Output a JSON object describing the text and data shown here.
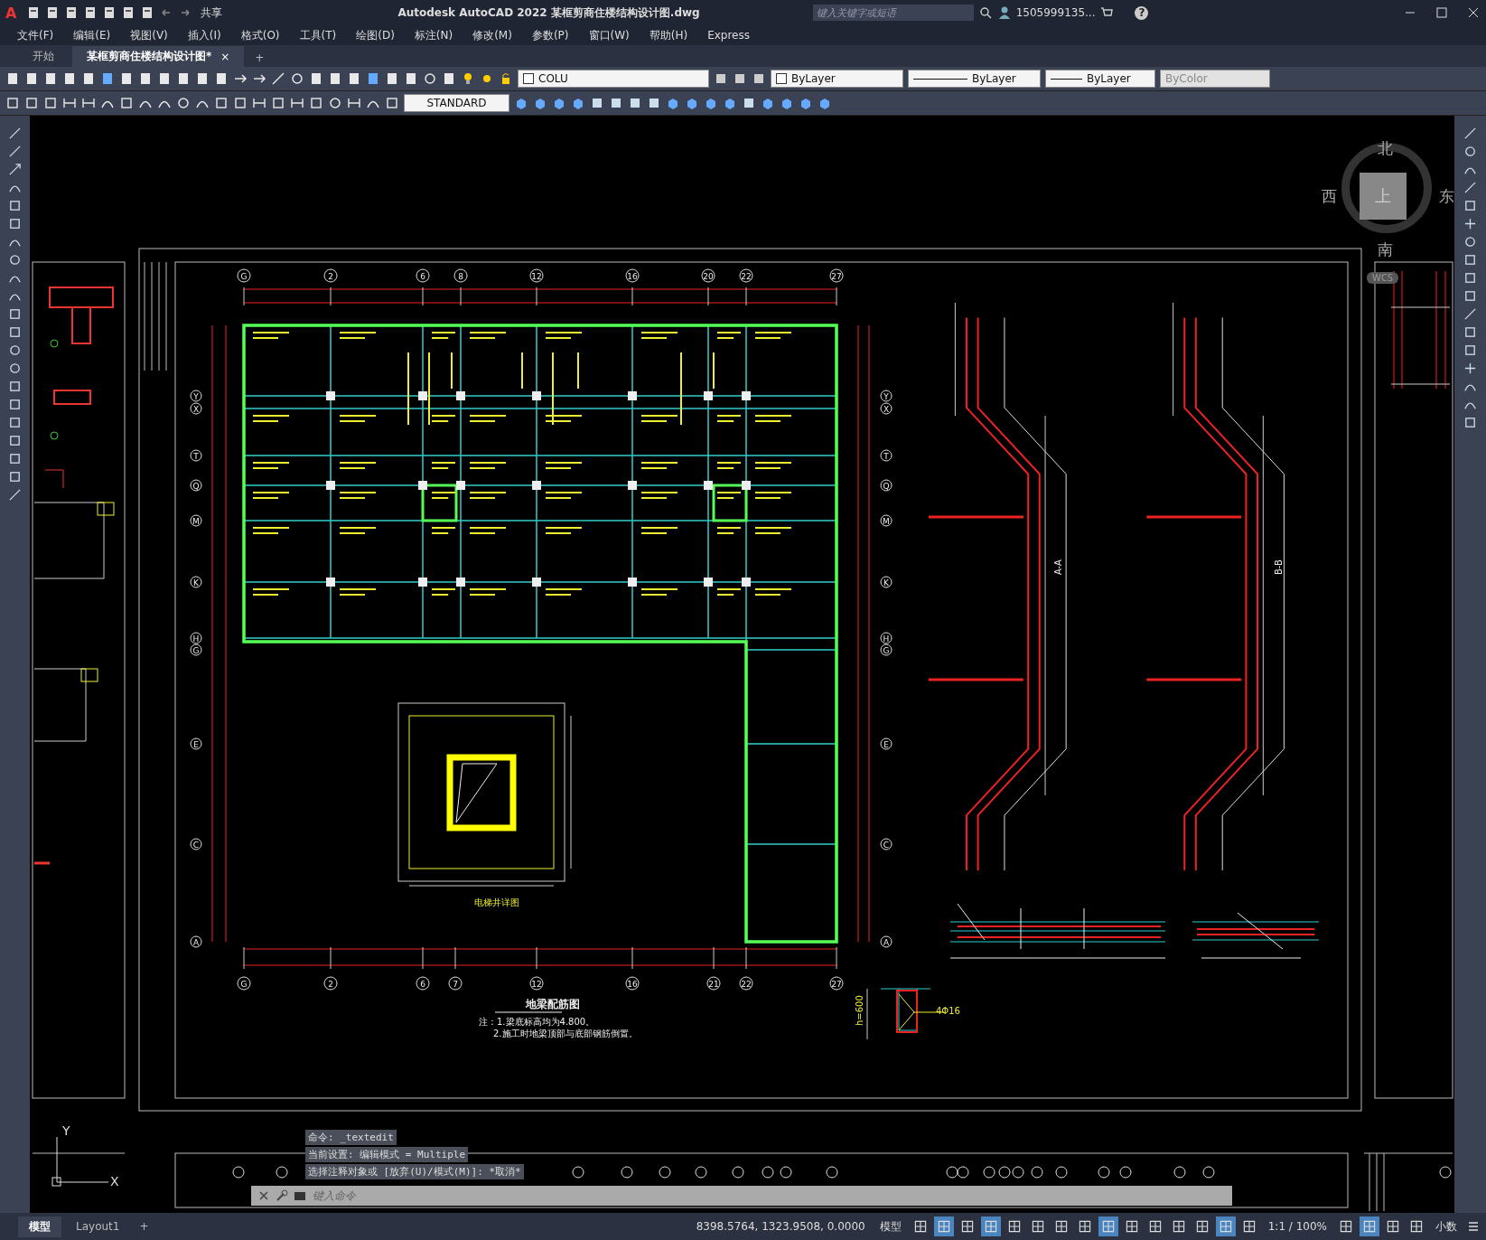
{
  "title_bar": {
    "app_menu": "A",
    "share": "共享",
    "title": "Autodesk AutoCAD 2022   某框剪商住楼结构设计图.dwg",
    "search": {
      "placeholder": "键入关键字或短语"
    },
    "user": "1505999135...",
    "help": "?"
  },
  "menu": [
    "文件(F)",
    "编辑(E)",
    "视图(V)",
    "插入(I)",
    "格式(O)",
    "工具(T)",
    "绘图(D)",
    "标注(N)",
    "修改(M)",
    "参数(P)",
    "窗口(W)",
    "帮助(H)",
    "Express"
  ],
  "tabs": [
    {
      "label": "开始",
      "selected": false
    },
    {
      "label": "某框剪商住楼结构设计图*",
      "selected": true
    }
  ],
  "tab_close": "×",
  "tab_add": "+",
  "toolbar": {
    "layer": "COLU",
    "color_control": "ByLayer",
    "linetype": "ByLayer",
    "lineweight": "ByLayer",
    "plot_style": "ByColor",
    "dim_style": "STANDARD"
  },
  "drawing": {
    "top_axes": [
      "G",
      "2",
      "6",
      "8",
      "12",
      "16",
      "20",
      "22",
      "27"
    ],
    "bottom_axes": [
      "G",
      "2",
      "6",
      "7",
      "12",
      "16",
      "21",
      "22",
      "27"
    ],
    "left_axes": [
      "Y",
      "X",
      "T",
      "Q",
      "M",
      "K",
      "H",
      "G",
      "E",
      "C",
      "A"
    ],
    "right_axes": [
      "Y",
      "X",
      "T",
      "Q",
      "M",
      "K",
      "H",
      "G",
      "E",
      "C",
      "A"
    ],
    "plan_title": "地梁配筋图",
    "notes": [
      "注：1.梁底标高均为4.800。",
      "2.施工时地梁顶部与底部钢筋倒置。"
    ],
    "elevator_label": "电梯井详图",
    "section_labels": [
      "A-A",
      "B-B"
    ],
    "detail_rebar": "4Φ16",
    "detail_height": "h=600"
  },
  "viewcube": {
    "north": "北",
    "west": "西",
    "east": "东",
    "south": "南",
    "top": "上",
    "ucs": "WCS"
  },
  "ucs": {
    "y": "Y",
    "x": "X"
  },
  "command": {
    "history": [
      "命令: _textedit",
      "当前设置: 编辑模式 = Multiple",
      "选择注释对象或 [放弃(U)/模式(M)]: *取消*"
    ],
    "placeholder": "键入命令"
  },
  "layout_tabs": [
    {
      "label": "模型",
      "selected": true
    },
    {
      "label": "Layout1",
      "selected": false
    }
  ],
  "layout_add": "+",
  "status_bar": {
    "coordinates": "8398.5764, 1323.9508, 0.0000",
    "space": "模型",
    "scale": "1:1 / 100%",
    "units": "小数",
    "toggles": [
      {
        "on": false
      },
      {
        "on": true
      },
      {
        "on": false
      },
      {
        "on": true
      },
      {
        "on": false
      },
      {
        "on": false
      },
      {
        "on": false
      },
      {
        "on": false
      },
      {
        "on": true
      },
      {
        "on": false
      },
      {
        "on": false
      },
      {
        "on": false
      },
      {
        "on": false
      },
      {
        "on": true
      },
      {
        "on": false
      },
      {
        "on": false
      },
      {
        "on": true
      },
      {
        "on": false
      },
      {
        "on": false
      }
    ]
  }
}
